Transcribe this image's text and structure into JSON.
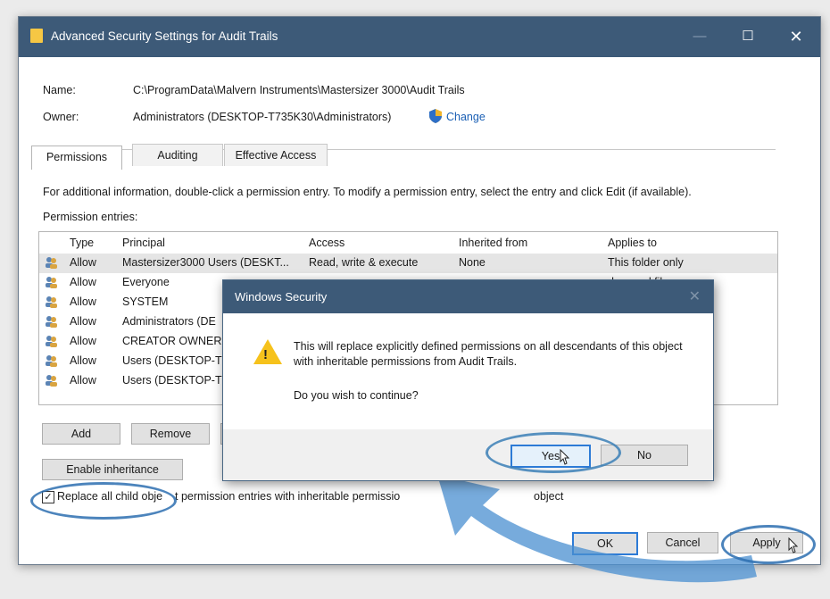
{
  "window": {
    "title": "Advanced Security Settings for Audit Trails",
    "min_glyph": "—",
    "max_glyph": "☐",
    "close_glyph": "✕"
  },
  "info": {
    "name_label": "Name:",
    "name_value": "C:\\ProgramData\\Malvern Instruments\\Mastersizer 3000\\Audit Trails",
    "owner_label": "Owner:",
    "owner_value": "Administrators (DESKTOP-T735K30\\Administrators)",
    "change_link": "Change"
  },
  "tabs": [
    {
      "label": "Permissions",
      "active": true
    },
    {
      "label": "Auditing",
      "active": false
    },
    {
      "label": "Effective Access",
      "active": false
    }
  ],
  "instructions": "For additional information, double-click a permission entry. To modify a permission entry, select the entry and click Edit (if available).",
  "entries_label": "Permission entries:",
  "table": {
    "headers": {
      "type": "Type",
      "principal": "Principal",
      "access": "Access",
      "inherited": "Inherited from",
      "applies": "Applies to"
    },
    "rows": [
      {
        "type": "Allow",
        "principal": "Mastersizer3000 Users (DESKT...",
        "access": "Read, write & execute",
        "inherited": "None",
        "applies": "This folder only"
      },
      {
        "type": "Allow",
        "principal": "Everyone",
        "access": "",
        "inherited": "",
        "applies": "ders and files"
      },
      {
        "type": "Allow",
        "principal": "SYSTEM",
        "access": "",
        "inherited": "",
        "applies": "ders and files"
      },
      {
        "type": "Allow",
        "principal": "Administrators (DE",
        "access": "",
        "inherited": "",
        "applies": "ders and files"
      },
      {
        "type": "Allow",
        "principal": "CREATOR OWNER",
        "access": "",
        "inherited": "",
        "applies": "s only"
      },
      {
        "type": "Allow",
        "principal": "Users (DESKTOP-T",
        "access": "",
        "inherited": "",
        "applies": "ders and files"
      },
      {
        "type": "Allow",
        "principal": "Users (DESKTOP-T",
        "access": "",
        "inherited": "",
        "applies": "bfolders"
      }
    ]
  },
  "buttons": {
    "add": "Add",
    "remove": "Remove",
    "enable_inheritance": "Enable inheritance",
    "ok": "OK",
    "cancel": "Cancel",
    "apply": "Apply"
  },
  "replace_checkbox": {
    "checked": true,
    "label_start": "Replace all child obje",
    "label_mid": "t permission entries with inheritable permissio",
    "label_end": "object"
  },
  "dialog": {
    "title": "Windows Security",
    "close_glyph": "✕",
    "message": "This will replace explicitly defined permissions on all descendants of this object with inheritable permissions from Audit Trails.",
    "question": "Do you wish to continue?",
    "yes": "Yes",
    "no": "No"
  },
  "colors": {
    "titlebar": "#3d5a78",
    "highlight_ring": "#2d6fb0",
    "arrow": "#4a8fd0",
    "link": "#1a5fb4"
  }
}
